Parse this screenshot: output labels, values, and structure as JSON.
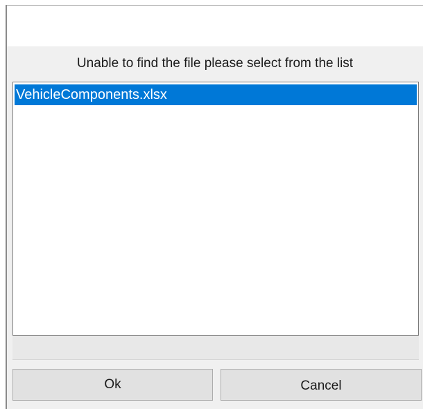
{
  "dialog": {
    "message": "Unable to find the file please select from the list",
    "file_list": {
      "items": [
        {
          "label": "VehicleComponents.xlsx",
          "selected": true
        }
      ]
    },
    "buttons": {
      "ok_label": "Ok",
      "cancel_label": "Cancel"
    }
  },
  "colors": {
    "selection": "#0078d7",
    "dialog_background": "#f0f0f0",
    "button_background": "#e1e1e1"
  }
}
